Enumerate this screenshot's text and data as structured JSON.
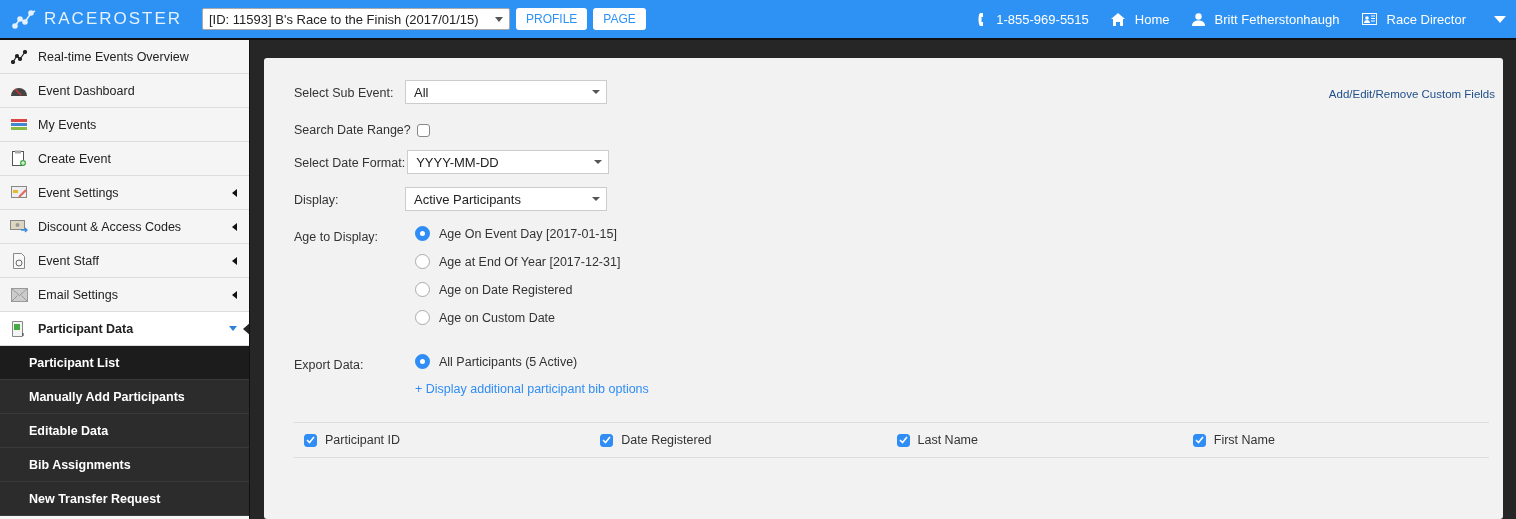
{
  "header": {
    "logo": {
      "part_1": "RACE",
      "part_2": "ROSTER"
    },
    "event_select": {
      "value": "[ID: 11593] B's Race to the Finish (2017/01/15)"
    },
    "buttons": [
      "PROFILE",
      "PAGE"
    ],
    "phone": "1-855-969-5515",
    "home": "Home",
    "user": "Britt Fetherstonhaugh",
    "role": "Race Director"
  },
  "sidebar": {
    "items": [
      {
        "label": "Real-time Events Overview",
        "kind": "link"
      },
      {
        "label": "Event Dashboard",
        "kind": "link"
      },
      {
        "label": "My Events",
        "kind": "link"
      },
      {
        "label": "Create Event",
        "kind": "link"
      },
      {
        "label": "Event Settings",
        "kind": "menu",
        "expanded": false
      },
      {
        "label": "Discount & Access Codes",
        "kind": "menu",
        "expanded": false
      },
      {
        "label": "Event Staff",
        "kind": "menu",
        "expanded": false
      },
      {
        "label": "Email Settings",
        "kind": "menu",
        "expanded": false
      },
      {
        "label": "Participant Data",
        "kind": "menu",
        "expanded": true,
        "children": [
          {
            "label": "Participant List",
            "selected": true
          },
          {
            "label": "Manually Add Participants",
            "selected": false
          },
          {
            "label": "Editable Data",
            "selected": false
          },
          {
            "label": "Bib Assignments",
            "selected": false
          },
          {
            "label": "New Transfer Request",
            "selected": false
          }
        ]
      }
    ]
  },
  "form": {
    "custom_fields_link": "Add/Edit/Remove Custom Fields",
    "fields": [
      {
        "label": "Select Sub Event:",
        "kind": "select",
        "value": "All"
      },
      {
        "label": "Search Date Range?",
        "kind": "checkbox",
        "checked": false
      },
      {
        "label": "Select Date Format:",
        "kind": "select",
        "value": "YYYY-MM-DD"
      },
      {
        "label": "Display:",
        "kind": "select",
        "value": "Active Participants"
      },
      {
        "label": "Age to Display:",
        "kind": "radio",
        "options": [
          {
            "label": "Age On Event Day [2017-01-15]",
            "selected": true
          },
          {
            "label": "Age at End Of Year [2017-12-31]",
            "selected": false
          },
          {
            "label": "Age on Date Registered",
            "selected": false
          },
          {
            "label": "Age on Custom Date",
            "selected": false
          }
        ]
      },
      {
        "label": "Export Data:",
        "kind": "radio",
        "options": [
          {
            "label": "All Participants (5 Active)",
            "selected": true
          }
        ],
        "link": "+ Display additional participant bib options"
      }
    ],
    "columns": [
      {
        "label": "Participant ID",
        "checked": true
      },
      {
        "label": "Date Registered",
        "checked": true
      },
      {
        "label": "Last Name",
        "checked": true
      },
      {
        "label": "First Name",
        "checked": true
      }
    ]
  }
}
